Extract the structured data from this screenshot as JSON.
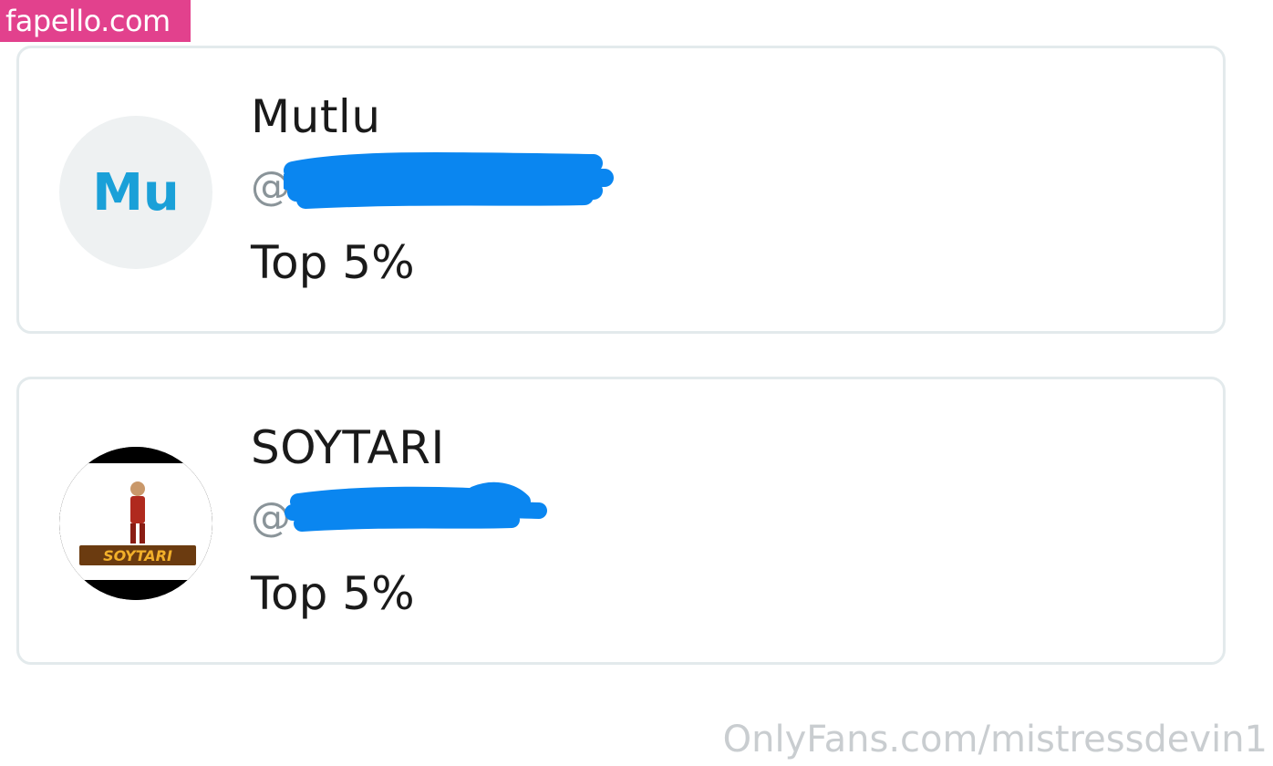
{
  "watermark": {
    "site_badge": "fapello.com",
    "footer": "OnlyFans.com/mistressdevin1"
  },
  "colors": {
    "accent": "#1aa0d8",
    "badge": "#e2418d",
    "scribble": "#0a86f0",
    "card_border": "#e3eaec"
  },
  "cards": [
    {
      "avatar_initials": "Mu",
      "name": "Mutlu",
      "handle_visible": "@",
      "rank": "Top 5%"
    },
    {
      "avatar_logo_text": "SOYTARI",
      "name": "SOYTARI",
      "handle_visible": "@",
      "rank": "Top 5%"
    }
  ]
}
